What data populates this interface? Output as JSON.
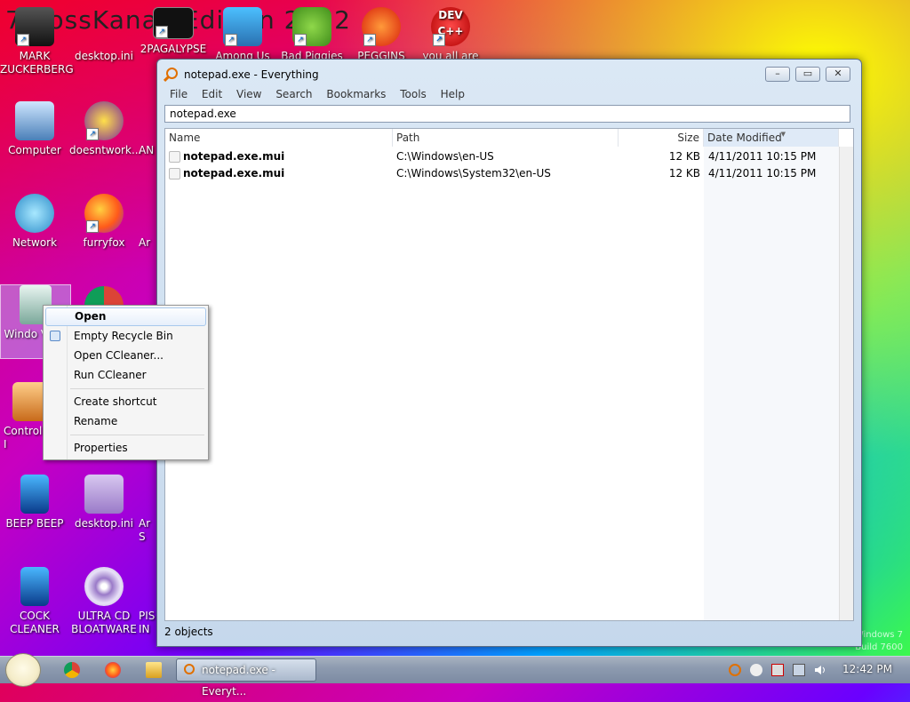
{
  "wallpaper": {
    "text": "7...ossKanae Edition 2012",
    "watermark_line1": "Windows 7",
    "watermark_line2": "Build 7600"
  },
  "desktop_icons": {
    "mark_zuckerberg": "MARK ZUCKERBERG",
    "desktop_ini_1": "desktop.ini",
    "apocalypse": "2PAGALYPSE",
    "among_us": "Among Us",
    "bad_piggies": "Bad Piggies",
    "peggins": "PEGGINS",
    "you_all_are": "you all are",
    "computer": "Computer",
    "doesntwork": "doesntwork...",
    "an1": "AN",
    "network": "Network",
    "furryfox": "furryfox",
    "an2": "Ar",
    "recycle": "Windo Vista",
    "chrome_partial": "",
    "control_panel": "Control I",
    "beep_beep": "BEEP BEEP",
    "desktop_ini_2": "desktop.ini",
    "an3": "Ar S",
    "cock_cleaner": "COCK CLEANER",
    "ultra_cd": "ULTRA CD BLOATWARE",
    "pis": "PIS IN"
  },
  "window": {
    "title": "notepad.exe - Everything",
    "minimize": "–",
    "maximize": "▭",
    "close": "✕",
    "menu": [
      "File",
      "Edit",
      "View",
      "Search",
      "Bookmarks",
      "Tools",
      "Help"
    ],
    "search_value": "notepad.exe",
    "columns": {
      "name": "Name",
      "path": "Path",
      "size": "Size",
      "date": "Date Modified"
    },
    "rows": [
      {
        "name": "notepad.exe.mui",
        "path": "C:\\Windows\\en-US",
        "size": "12 KB",
        "date": "4/11/2011 10:15 PM"
      },
      {
        "name": "notepad.exe.mui",
        "path": "C:\\Windows\\System32\\en-US",
        "size": "12 KB",
        "date": "4/11/2011 10:15 PM"
      }
    ],
    "status": "2 objects"
  },
  "context_menu": {
    "open": "Open",
    "empty_recycle": "Empty Recycle Bin",
    "open_ccleaner": "Open CCleaner...",
    "run_ccleaner": "Run CCleaner",
    "create_shortcut": "Create shortcut",
    "rename": "Rename",
    "properties": "Properties"
  },
  "taskbar": {
    "active_task": "notepad.exe - Everyt...",
    "clock": "12:42 PM"
  },
  "colors": {
    "accent": "#e07000",
    "taskbar": "#8e9bb0",
    "window_frame": "#c5d8ec"
  }
}
